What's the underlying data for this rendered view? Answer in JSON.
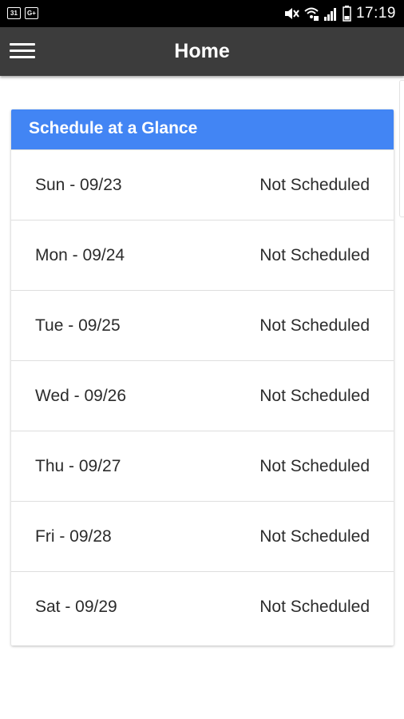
{
  "status_bar": {
    "left_icons": [
      "calendar-icon",
      "google-plus-icon"
    ],
    "left_icon_labels": [
      "31",
      "G+"
    ],
    "right_icons": [
      "mute-icon",
      "wifi-icon",
      "signal-icon",
      "battery-icon"
    ],
    "time": "17:19"
  },
  "app_bar": {
    "title": "Home",
    "menu_icon": "hamburger-menu-icon",
    "background": "#3c3c3c"
  },
  "schedule": {
    "title": "Schedule at a Glance",
    "header_color": "#4285f4",
    "days": [
      {
        "day": "Sun - 09/23",
        "status": "Not Scheduled"
      },
      {
        "day": "Mon - 09/24",
        "status": "Not Scheduled"
      },
      {
        "day": "Tue - 09/25",
        "status": "Not Scheduled"
      },
      {
        "day": "Wed - 09/26",
        "status": "Not Scheduled"
      },
      {
        "day": "Thu - 09/27",
        "status": "Not Scheduled"
      },
      {
        "day": "Fri - 09/28",
        "status": "Not Scheduled"
      },
      {
        "day": "Sat - 09/29",
        "status": "Not Scheduled"
      }
    ]
  }
}
